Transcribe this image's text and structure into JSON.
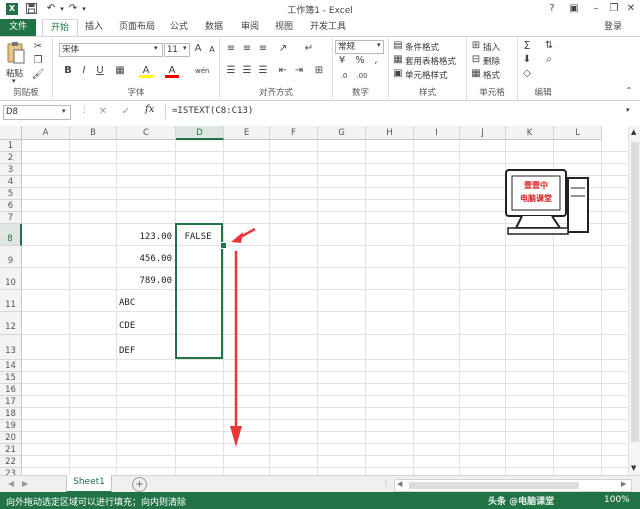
{
  "window": {
    "title": "工作簿1 - Excel",
    "minimize_icon": "–",
    "restore_icon": "❐",
    "close_icon": "✕",
    "help_icon": "?",
    "ribbon_toggle_icon": "▣"
  },
  "quick_access": {
    "save_icon": "save",
    "undo_icon": "undo",
    "redo_icon": "redo"
  },
  "tabs": {
    "file": "文件",
    "items": [
      "开始",
      "插入",
      "页面布局",
      "公式",
      "数据",
      "审阅",
      "视图",
      "开发工具"
    ],
    "active": "开始",
    "signin": "登录"
  },
  "ribbon": {
    "clipboard": {
      "paste": "粘贴",
      "label": "剪贴板"
    },
    "font": {
      "name": "宋体",
      "size": "11",
      "bold": "B",
      "italic": "I",
      "underline": "U",
      "grow": "A",
      "shrink": "A",
      "fill_color": "A",
      "font_color": "A",
      "wen": "wén",
      "label": "字体"
    },
    "alignment": {
      "label": "对齐方式"
    },
    "number": {
      "format": "常规",
      "label": "数字",
      "percent": "%",
      "comma": ","
    },
    "styles": {
      "conditional": "条件格式",
      "table": "套用表格格式",
      "cell": "单元格样式",
      "label": "样式"
    },
    "cells": {
      "insert": "插入",
      "delete": "删除",
      "format": "格式",
      "label": "单元格"
    },
    "editing": {
      "sum": "Σ",
      "label": "编辑"
    }
  },
  "formula_bar": {
    "name_box": "D8",
    "cancel": "✕",
    "enter": "✓",
    "fx": "fx",
    "formula": "=ISTEXT(C8:C13)"
  },
  "grid": {
    "columns": [
      "A",
      "B",
      "C",
      "D",
      "E",
      "F",
      "G",
      "H",
      "I",
      "J",
      "K",
      "L"
    ],
    "selected_column": "D",
    "rows": [
      "1",
      "2",
      "3",
      "4",
      "5",
      "6",
      "7",
      "8",
      "9",
      "10",
      "11",
      "12",
      "13",
      "14",
      "15",
      "16",
      "17",
      "18",
      "19",
      "20",
      "21",
      "22",
      "23"
    ],
    "selected_row": "8",
    "cells": {
      "C8": "123.00",
      "C9": "456.00",
      "C10": "789.00",
      "C11": "ABC",
      "C12": "CDE",
      "C13": "DEF",
      "D8": "FALSE"
    },
    "logo": {
      "line1": "壹壹中",
      "line2": "电脑课堂"
    }
  },
  "sheets": {
    "tabs": [
      "Sheet1"
    ],
    "active": "Sheet1",
    "add": "+"
  },
  "status": {
    "message": "向外拖动选定区域可以进行填充；向内则清除",
    "zoom": "100%",
    "watermark": "头条 @电脑课堂"
  },
  "colors": {
    "accent": "#217346",
    "arrow": "#e8373a"
  }
}
